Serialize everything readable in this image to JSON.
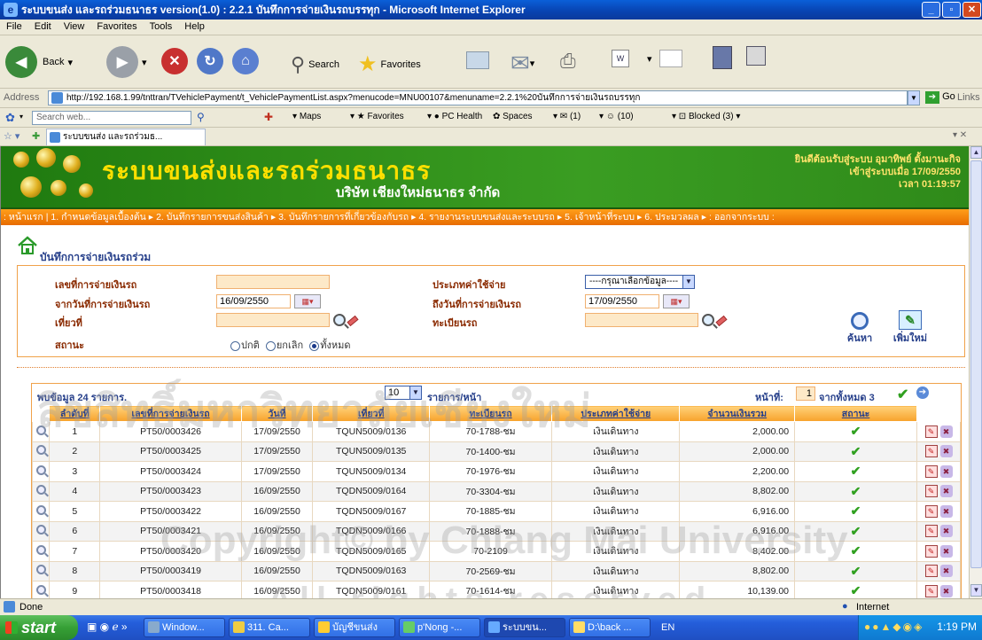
{
  "window": {
    "title": "ระบบขนส่ง และรถร่วมธนาธร version(1.0) : 2.2.1 บันทึกการจ่ายเงินรถบรรทุก - Microsoft Internet Explorer"
  },
  "menu": [
    "File",
    "Edit",
    "View",
    "Favorites",
    "Tools",
    "Help"
  ],
  "toolbar": {
    "back": "Back",
    "search": "Search",
    "favorites": "Favorites"
  },
  "address": {
    "label": "Address",
    "url": "http://192.168.1.99/tnttran/TVehiclePayment/t_VehiclePaymentList.aspx?menucode=MNU00107&menuname=2.2.1%20บันทึกการจ่ายเงินรถบรรทุก",
    "go": "Go",
    "links": "Links"
  },
  "linksbar": {
    "search_placeholder": "Search web...",
    "maps": "Maps",
    "favorites": "Favorites",
    "pchealth": "PC Health",
    "spaces": "Spaces",
    "mail": "(1)",
    "messenger": "(10)",
    "blocked": "Blocked (3)"
  },
  "tab": {
    "label": "ระบบขนส่ง และรถร่วมธ..."
  },
  "banner": {
    "system_name": "ระบบขนส่งและรถร่วมธนาธร",
    "company": "บริษัท เชียงใหม่ธนาธร จำกัด",
    "welcome_line1": "ยินดีต้อนรับสู่ระบบ อุมาทิพย์ ตั้งมานะกิจ",
    "welcome_line2": "เข้าสู่ระบบเมื่อ 17/09/2550",
    "welcome_line3": "เวลา 01:19:57"
  },
  "nav": [
    "หน้าแรก",
    "1. กำหนดข้อมูลเบื้องต้น",
    "2. บันทึกรายการขนส่งสินค้า",
    "3. บันทึกรายการที่เกี่ยวข้องกับรถ",
    "4. รายงานระบบขนส่งและระบบรถ",
    "5. เจ้าหน้าที่ระบบ",
    "6. ประมวลผล",
    "ออกจากระบบ"
  ],
  "page": {
    "title": "บันทึกการจ่ายเงินรถร่วม"
  },
  "form": {
    "payment_no_label": "เลขที่การจ่ายเงินรถ",
    "from_date_label": "จากวันที่การจ่ายเงินรถ",
    "from_date": "16/09/2550",
    "trip_label": "เที่ยวที่",
    "status_label": "สถานะ",
    "expense_type_label": "ประเภทค่าใช้จ่าย",
    "expense_type_value": "----กรุณาเลือกข้อมูล----",
    "to_date_label": "ถึงวันที่การจ่ายเงินรถ",
    "to_date": "17/09/2550",
    "plate_label": "ทะเบียนรถ",
    "status_normal": "ปกติ",
    "status_cancel": "ยกเลิก",
    "status_all": "ทั้งหมด",
    "search_label": "ค้นหา",
    "add_label": "เพิ่มใหม่"
  },
  "list": {
    "record_count": "พบข้อมูล 24 รายการ.",
    "page_size": "10",
    "page_size_label": "รายการ/หน้า",
    "page_label": "หน้าที่:",
    "page_value": "1",
    "page_of": "จากทั้งหมด 3",
    "columns": [
      "ลำดับที่",
      "เลขที่การจ่ายเงินรถ",
      "วันที่",
      "เที่ยวที่",
      "ทะเบียนรถ",
      "ประเภทค่าใช้จ่าย",
      "จำนวนเงินรวม",
      "สถานะ"
    ],
    "rows": [
      {
        "no": "1",
        "payment_no": "PT50/0003426",
        "date": "17/09/2550",
        "trip": "TQUN5009/0136",
        "plate": "70-1788-ชม",
        "type": "เงินเดินทาง",
        "amount": "2,000.00"
      },
      {
        "no": "2",
        "payment_no": "PT50/0003425",
        "date": "17/09/2550",
        "trip": "TQUN5009/0135",
        "plate": "70-1400-ชม",
        "type": "เงินเดินทาง",
        "amount": "2,000.00"
      },
      {
        "no": "3",
        "payment_no": "PT50/0003424",
        "date": "17/09/2550",
        "trip": "TQUN5009/0134",
        "plate": "70-1976-ชม",
        "type": "เงินเดินทาง",
        "amount": "2,200.00"
      },
      {
        "no": "4",
        "payment_no": "PT50/0003423",
        "date": "16/09/2550",
        "trip": "TQDN5009/0164",
        "plate": "70-3304-ชม",
        "type": "เงินเดินทาง",
        "amount": "8,802.00"
      },
      {
        "no": "5",
        "payment_no": "PT50/0003422",
        "date": "16/09/2550",
        "trip": "TQDN5009/0167",
        "plate": "70-1885-ชม",
        "type": "เงินเดินทาง",
        "amount": "6,916.00"
      },
      {
        "no": "6",
        "payment_no": "PT50/0003421",
        "date": "16/09/2550",
        "trip": "TQDN5009/0166",
        "plate": "70-1888-ชม",
        "type": "เงินเดินทาง",
        "amount": "6,916.00"
      },
      {
        "no": "7",
        "payment_no": "PT50/0003420",
        "date": "16/09/2550",
        "trip": "TQDN5009/0165",
        "plate": "70-2109",
        "type": "เงินเดินทาง",
        "amount": "8,402.00"
      },
      {
        "no": "8",
        "payment_no": "PT50/0003419",
        "date": "16/09/2550",
        "trip": "TQDN5009/0163",
        "plate": "70-2569-ชม",
        "type": "เงินเดินทาง",
        "amount": "8,802.00"
      },
      {
        "no": "9",
        "payment_no": "PT50/0003418",
        "date": "16/09/2550",
        "trip": "TQDN5009/0161",
        "plate": "70-1614-ชม",
        "type": "เงินเดินทาง",
        "amount": "10,139.00"
      }
    ]
  },
  "statusbar": {
    "left": "Done",
    "right": "Internet"
  },
  "taskbar": {
    "start": "start",
    "tasks": [
      "Window...",
      "311. Ca...",
      "บัญชีขนส่ง",
      "p'Nong -...",
      "ระบบขน...",
      "D:\\back ..."
    ],
    "lang": "EN",
    "clock": "1:19 PM"
  },
  "watermark": {
    "line1": "ลิขสิทธิ์มหาวิทยาลัยเชียงใหม่",
    "line2": "Copyright© by Chiang Mai University",
    "line3": "All rights reserved"
  },
  "colors": {
    "banner_green": "#2e8c18",
    "nav_orange": "#f08a10",
    "header_orange": "#f7a22a",
    "title_blue": "#27408b",
    "label_brown": "#8a2a00"
  }
}
